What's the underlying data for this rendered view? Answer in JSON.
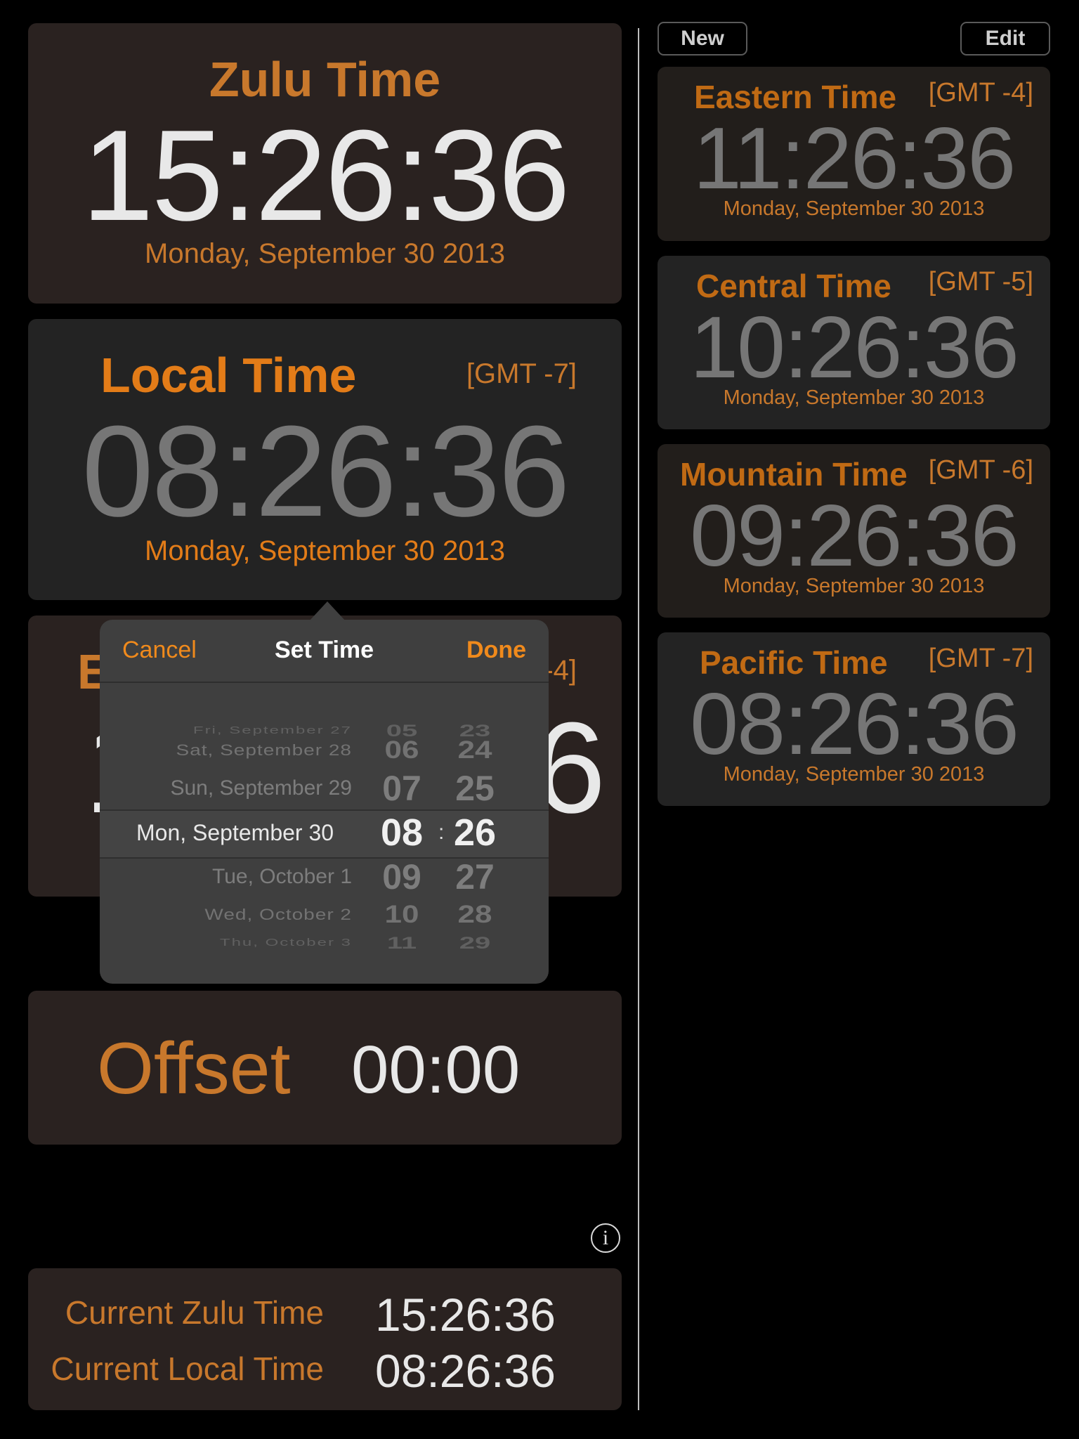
{
  "zulu": {
    "title": "Zulu Time",
    "time": "15:26:36",
    "date": "Monday, September 30 2013"
  },
  "local": {
    "title": "Local Time",
    "gmt": "[GMT -7]",
    "time": "08:26:36",
    "date": "Monday, September 30 2013"
  },
  "hidden_card": {
    "title_partial": "E",
    "gmt_partial": "-4]",
    "time_left_partial": "1",
    "time_right_partial": "6"
  },
  "picker": {
    "cancel": "Cancel",
    "title": "Set Time",
    "done": "Done",
    "rows": [
      {
        "date": "Fri, September 27",
        "hour": "05",
        "minute": "23"
      },
      {
        "date": "Sat, September 28",
        "hour": "06",
        "minute": "24"
      },
      {
        "date": "Sun, September 29",
        "hour": "07",
        "minute": "25"
      },
      {
        "date": "Mon, September 30",
        "hour": "08",
        "minute": "26"
      },
      {
        "date": "Tue, October 1",
        "hour": "09",
        "minute": "27"
      },
      {
        "date": "Wed, October 2",
        "hour": "10",
        "minute": "28"
      },
      {
        "date": "Thu, October 3",
        "hour": "11",
        "minute": "29"
      }
    ],
    "separator": ":"
  },
  "offset": {
    "label": "Offset",
    "value": "00:00"
  },
  "current": {
    "zulu_label": "Current Zulu Time",
    "zulu_value": "15:26:36",
    "local_label": "Current Local Time",
    "local_value": "08:26:36"
  },
  "toolbar": {
    "new": "New",
    "edit": "Edit"
  },
  "zones": [
    {
      "title": "Eastern Time",
      "gmt": "[GMT -4]",
      "time": "11:26:36",
      "date": "Monday, September 30 2013"
    },
    {
      "title": "Central Time",
      "gmt": "[GMT -5]",
      "time": "10:26:36",
      "date": "Monday, September 30 2013"
    },
    {
      "title": "Mountain Time",
      "gmt": "[GMT -6]",
      "time": "09:26:36",
      "date": "Monday, September 30 2013"
    },
    {
      "title": "Pacific Time",
      "gmt": "[GMT -7]",
      "time": "08:26:36",
      "date": "Monday, September 30 2013"
    }
  ],
  "colors": {
    "accent": "#e37c18",
    "accent_muted": "#c8782c",
    "card_brown": "#2a2220",
    "card_gray": "#232323",
    "popover": "#3f3f3f"
  }
}
